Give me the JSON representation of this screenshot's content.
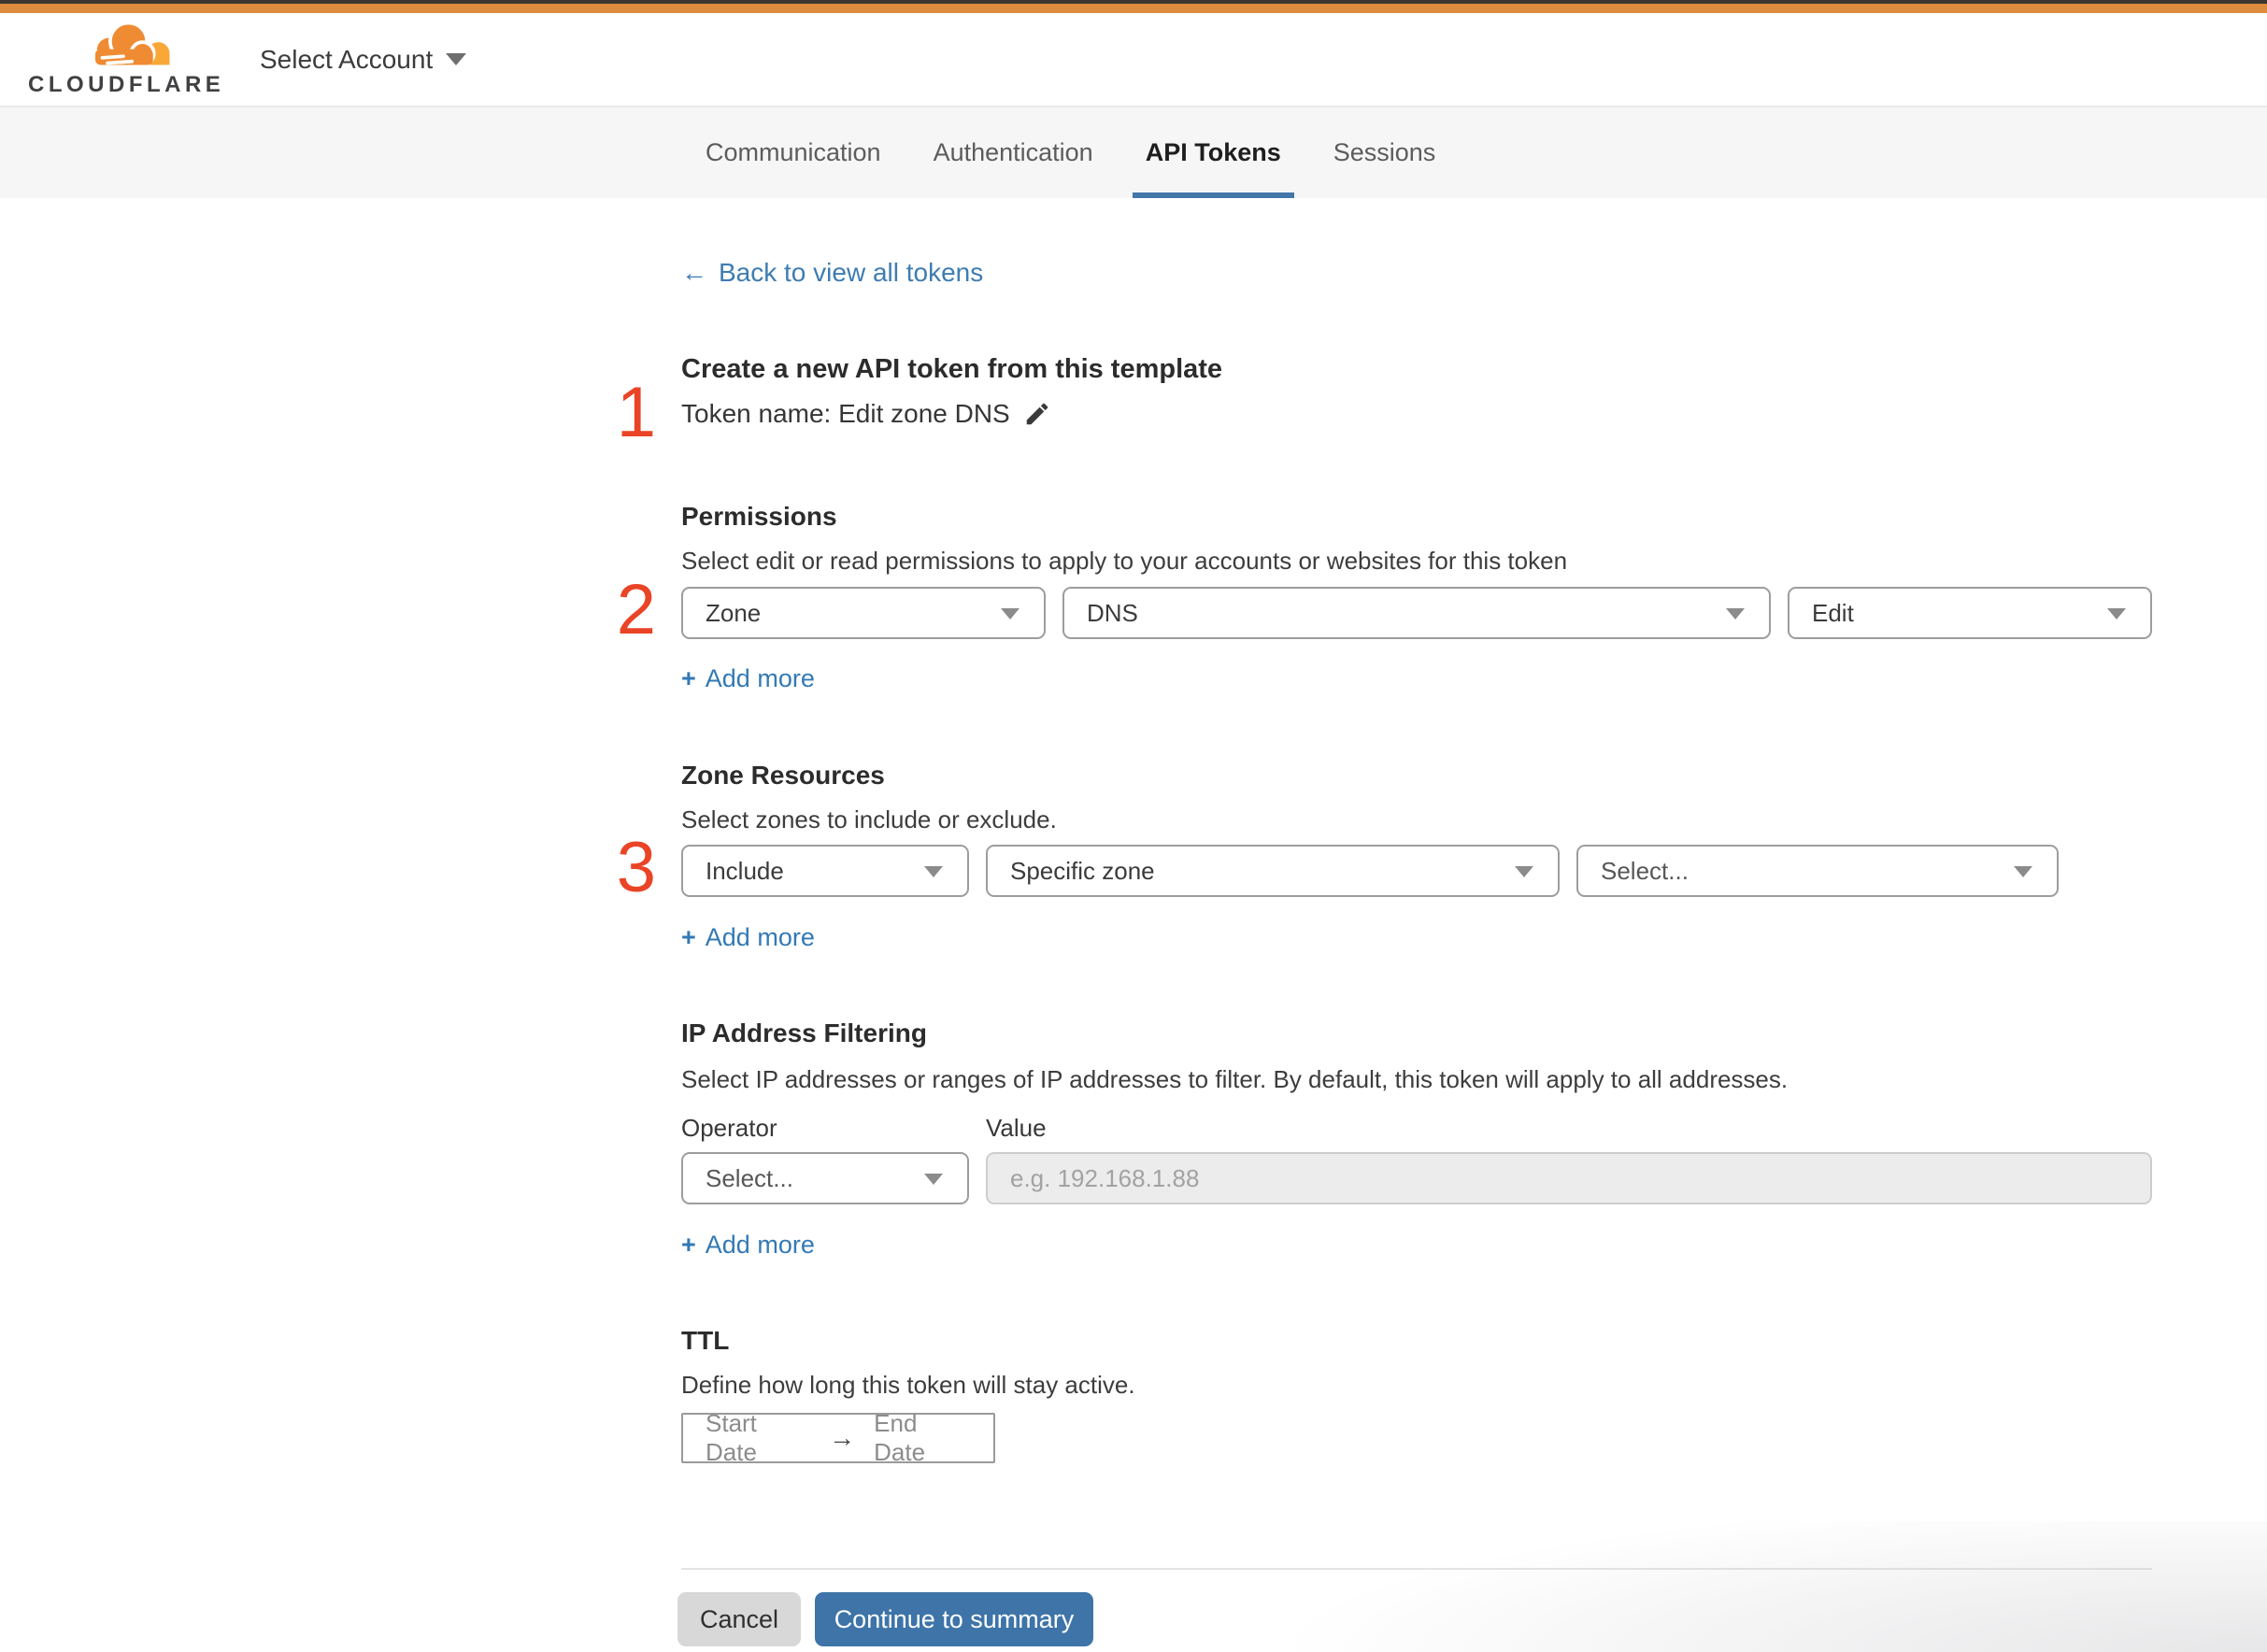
{
  "header": {
    "brand": "CLOUDFLARE",
    "account_selector_label": "Select Account"
  },
  "tabs": {
    "items": [
      {
        "label": "Communication"
      },
      {
        "label": "Authentication"
      },
      {
        "label": "API Tokens"
      },
      {
        "label": "Sessions"
      }
    ],
    "active_label": "API Tokens"
  },
  "back_link": {
    "arrow": "←",
    "label": "Back to view all tokens"
  },
  "template_section": {
    "step_number": "1",
    "heading": "Create a new API token from this template",
    "token_name": "Token name: Edit zone DNS"
  },
  "permissions": {
    "step_number": "2",
    "heading": "Permissions",
    "description": "Select edit or read permissions to apply to your accounts or websites for this token",
    "scope_select_value": "Zone",
    "service_select_value": "DNS",
    "access_select_value": "Edit",
    "add_more": {
      "plus": "+",
      "label": "Add more"
    }
  },
  "zone_resources": {
    "step_number": "3",
    "heading": "Zone Resources",
    "description": "Select zones to include or exclude.",
    "mode_select_value": "Include",
    "type_select_value": "Specific zone",
    "zone_select_placeholder": "Select...",
    "add_more": {
      "plus": "+",
      "label": "Add more"
    }
  },
  "ip_filtering": {
    "heading": "IP Address Filtering",
    "description": "Select IP addresses or ranges of IP addresses to filter. By default, this token will apply to all addresses.",
    "operator_label": "Operator",
    "value_label": "Value",
    "operator_select_placeholder": "Select...",
    "value_placeholder": "e.g. 192.168.1.88",
    "add_more": {
      "plus": "+",
      "label": "Add more"
    }
  },
  "ttl": {
    "heading": "TTL",
    "description": "Define how long this token will stay active.",
    "start_label": "Start Date",
    "range_arrow": "→",
    "end_label": "End Date"
  },
  "footer": {
    "cancel_label": "Cancel",
    "continue_label": "Continue to summary"
  },
  "colors": {
    "top_bar_orange": "#dd8b3e",
    "brand_cloud_orange": "#ef8b33",
    "brand_cloud_amber": "#f9a838",
    "link_blue": "#3e7cb1",
    "active_tab_blue": "#4377a9",
    "primary_button_blue": "#3e74a8",
    "step_number_red": "#ea4426"
  }
}
